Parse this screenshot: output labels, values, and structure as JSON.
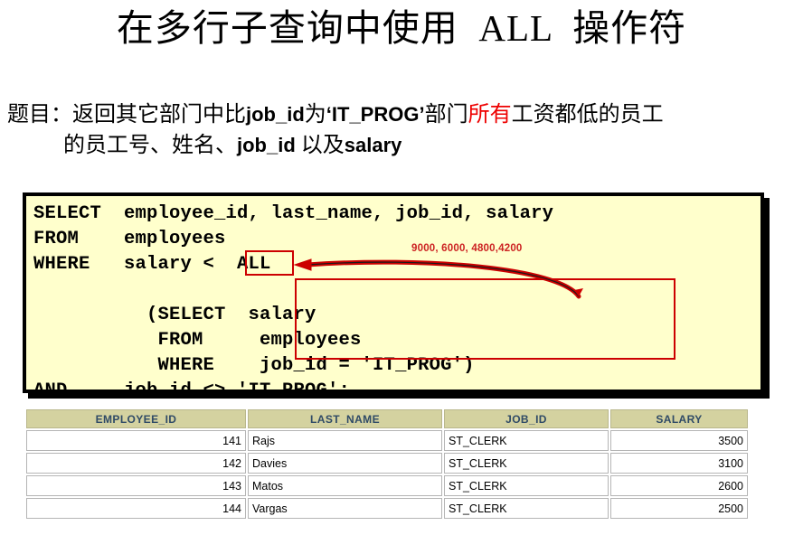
{
  "slide": {
    "title": "在多行子查询中使用  ALL  操作符",
    "subtitle": {
      "line1_part1": "题目：返回其它部门中比",
      "line1_jobid": "job_id",
      "line1_part2": "为",
      "line1_itprog": "‘IT_PROG’",
      "line1_part3": "部门",
      "line1_red": "所有",
      "line1_part4": "工资都低的员工",
      "line2_part1": "的员工号、姓名、",
      "line2_jobid": "job_id",
      "line2_part2": " 以及",
      "line2_salary": "salary"
    }
  },
  "sql": {
    "code": "SELECT  employee_id, last_name, job_id, salary\nFROM    employees\nWHERE   salary <  ALL\n\n          (SELECT  salary\n           FROM     employees\n           WHERE    job_id = 'IT_PROG')\nAND     job_id <> 'IT_PROG';",
    "highlight_keyword": "ALL",
    "annotation": "9000, 6000, 4800,4200",
    "highlight_color": "#cc0000",
    "background_color": "#ffffcc",
    "annotation_color": "#cc2222"
  },
  "results": {
    "columns": [
      "EMPLOYEE_ID",
      "LAST_NAME",
      "JOB_ID",
      "SALARY"
    ],
    "rows": [
      [
        "141",
        "Rajs",
        "ST_CLERK",
        "3500"
      ],
      [
        "142",
        "Davies",
        "ST_CLERK",
        "3100"
      ],
      [
        "143",
        "Matos",
        "ST_CLERK",
        "2600"
      ],
      [
        "144",
        "Vargas",
        "ST_CLERK",
        "2500"
      ]
    ],
    "header_background": "#d4d2a0",
    "header_text_color": "#2f4a66"
  }
}
